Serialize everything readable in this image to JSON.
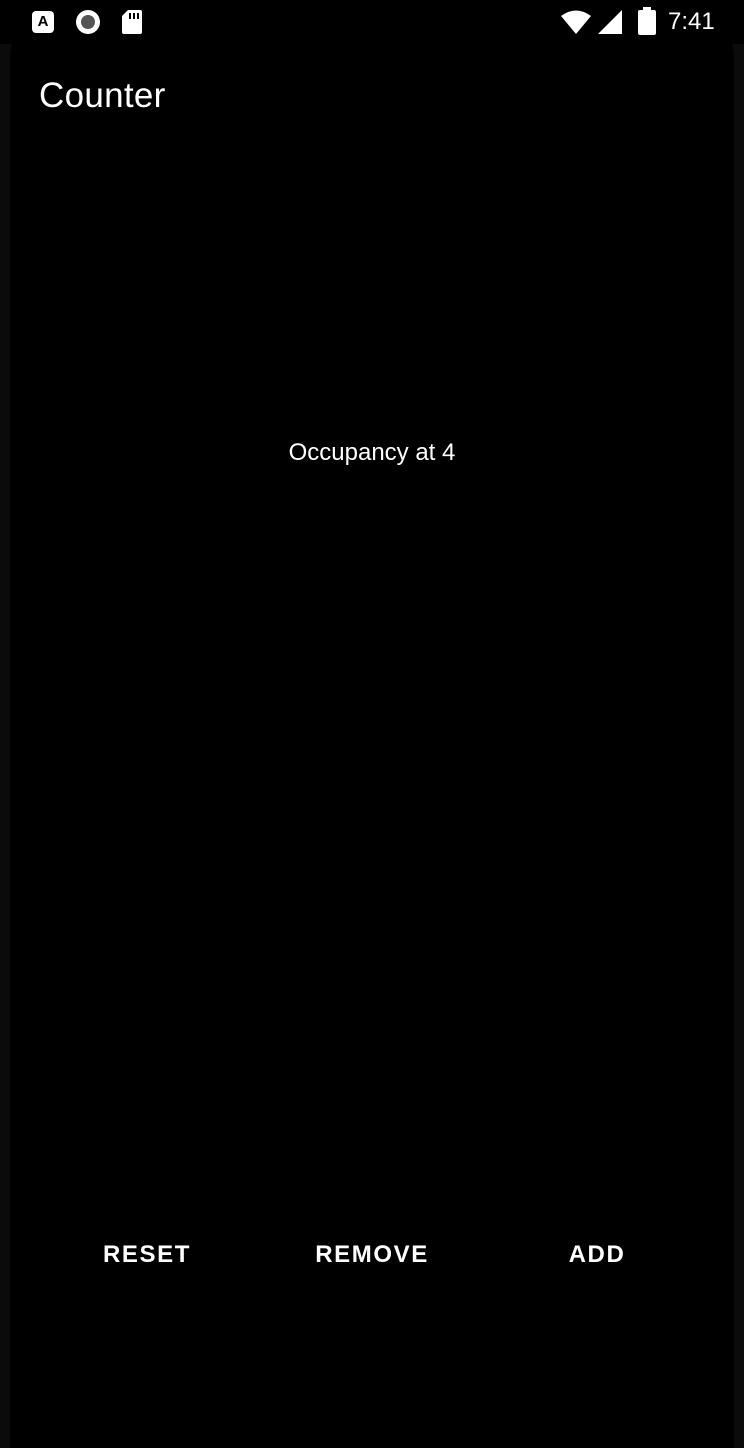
{
  "status_bar": {
    "time": "7:41",
    "notification_a_letter": "A",
    "icons": [
      "app-notification-a-icon",
      "record-icon",
      "sd-card-icon",
      "wifi-icon",
      "cell-signal-icon",
      "battery-icon"
    ]
  },
  "app_bar": {
    "title": "Counter"
  },
  "main": {
    "occupancy_text": "Occupancy at 4"
  },
  "buttons": {
    "reset_label": "RESET",
    "remove_label": "REMOVE",
    "add_label": "ADD"
  },
  "colors": {
    "background": "#000000",
    "text": "#ffffff"
  }
}
